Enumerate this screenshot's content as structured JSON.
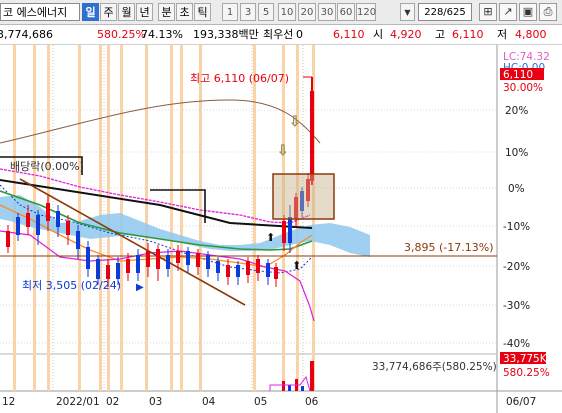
{
  "toolbar": {
    "stock_name": "코 에스에너지",
    "periods": [
      "일",
      "주",
      "월",
      "년",
      "분",
      "초",
      "틱"
    ],
    "active_period": "일",
    "intervals": [
      "1",
      "3",
      "5",
      "10",
      "20",
      "30",
      "60",
      "120"
    ],
    "counter": "228/625"
  },
  "quote": {
    "volume": "3,774,686",
    "change_pct": "580.25%",
    "turnover_pct": "74.13%",
    "amount": "193,338백만",
    "label_pref": "최우선",
    "pref_value": "0",
    "current": "6,110",
    "open_label": "시",
    "open": "4,920",
    "high_label": "고",
    "high": "6,110",
    "low_label": "저",
    "low": "4,800"
  },
  "chart": {
    "annotations": {
      "high": "최고 6,110 (06/07)",
      "low": "최저 3,505 (02/24)",
      "dividend": "배당락(0.00%)",
      "ref_line": "3,895 (-17.13%)",
      "volume_readout": "33,774,686주(580.25%)"
    },
    "right_axis": {
      "lc": "LC:74.32",
      "hc": "HC:0.00",
      "last_price": "6,110",
      "last_pct": "30.00%",
      "ticks": [
        "20%",
        "10%",
        "0%",
        "-10%",
        "-20%",
        "-30%",
        "-40%"
      ],
      "volume_box": "33,775K",
      "volume_pct": "580.25%"
    },
    "x_axis": [
      "12",
      "2022/01",
      "02",
      "03",
      "04",
      "05",
      "06",
      "06/07"
    ],
    "colors": {
      "up": "#e60012",
      "down": "#0b3bd8",
      "ma_magenta": "#e020e0",
      "ma_green": "#2a9a3a",
      "ma_black": "#111111",
      "cloud": "#8ec8f0",
      "ref_line": "#8b3a0a"
    }
  }
}
